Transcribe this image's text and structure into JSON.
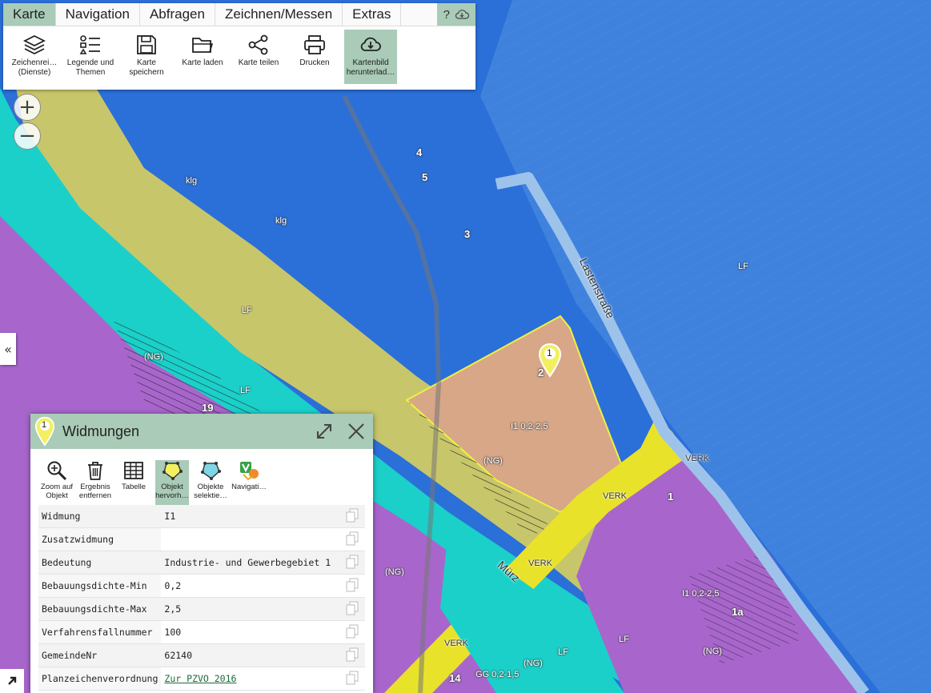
{
  "menu": {
    "tabs": [
      "Karte",
      "Navigation",
      "Abfragen",
      "Zeichnen/Messen",
      "Extras"
    ],
    "extra": "?",
    "tools": [
      {
        "label": "Zeichenrei… (Dienste)",
        "icon": "layers-icon"
      },
      {
        "label": "Legende und Themen",
        "icon": "legend-icon"
      },
      {
        "label": "Karte speichern",
        "icon": "save-icon"
      },
      {
        "label": "Karte laden",
        "icon": "folder-icon"
      },
      {
        "label": "Karte teilen",
        "icon": "share-icon"
      },
      {
        "label": "Drucken",
        "icon": "print-icon"
      },
      {
        "label": "Kartenbild herunterlad…",
        "icon": "cloud-download-icon"
      }
    ]
  },
  "map": {
    "labels": {
      "n4": "4",
      "n5": "5",
      "n3": "3",
      "n2": "2",
      "n1": "1",
      "n1a": "1a",
      "n19": "19",
      "n14": "14",
      "klg1": "klg",
      "klg2": "klg",
      "lf1": "LF",
      "lf2": "LF",
      "lf3": "LF",
      "lf4": "LF",
      "lf5": "LF",
      "ng1": "(NG)",
      "ng2": "(NG)",
      "ng3": "(NG)",
      "ng4": "(NG)",
      "ng5": "(NG)",
      "i1a": "I1 0,2-2,5",
      "i1b": "I1 0,2-2,5",
      "gg": "GG 0,2-1,5",
      "verk1": "VERK",
      "verk2": "VERK",
      "verk3": "VERK",
      "verk4": "VERK",
      "street1": "Lastenstraße",
      "street2": "Mürz",
      "marker": "1"
    }
  },
  "panel": {
    "title": "Widmungen",
    "marker": "1",
    "tools": [
      {
        "label": "Zoom auf Objekt",
        "icon": "zoom-icon"
      },
      {
        "label": "Ergebnis entfernen",
        "icon": "trash-icon"
      },
      {
        "label": "Tabelle",
        "icon": "table-icon"
      },
      {
        "label": "Objekt hervorh…",
        "icon": "highlight-icon"
      },
      {
        "label": "Objekte selektie…",
        "icon": "select-icon"
      },
      {
        "label": "Navigati…",
        "icon": "navigation-icon"
      }
    ],
    "rows": [
      {
        "key": "Widmung",
        "value": "I1"
      },
      {
        "key": "Zusatzwidmung",
        "value": ""
      },
      {
        "key": "Bedeutung",
        "value": "Industrie- und Gewerbegebiet 1"
      },
      {
        "key": "Bebauungsdichte-Min",
        "value": "0,2"
      },
      {
        "key": "Bebauungsdichte-Max",
        "value": "2,5"
      },
      {
        "key": "Verfahrensfallnummer",
        "value": "100"
      },
      {
        "key": "GemeindeNr",
        "value": "62140"
      },
      {
        "key": "Planzeichenverordnung",
        "value": "Zur PZVO 2016"
      }
    ]
  },
  "colors": {
    "blue": "#2b6fd8",
    "lightblue": "#4f8fe0",
    "yellow": "#c8c66a",
    "cyan": "#1bd0c9",
    "purple": "#a866cc",
    "peach": "#d7a788",
    "accent": "#a9cbb7"
  }
}
